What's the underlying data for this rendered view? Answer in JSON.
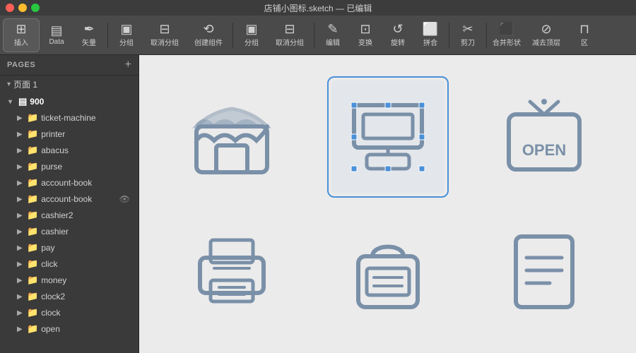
{
  "titlebar": {
    "title": "店铺小图标.sketch — 已编辑"
  },
  "toolbar": {
    "buttons": [
      {
        "label": "插入",
        "icon": "+",
        "id": "insert"
      },
      {
        "label": "Data",
        "icon": "≡",
        "id": "data"
      },
      {
        "label": "矢量",
        "icon": "✏",
        "id": "vector"
      },
      {
        "label": "分组",
        "icon": "⊞",
        "id": "group1"
      },
      {
        "label": "取消分组",
        "icon": "⊟",
        "id": "ungroup1"
      },
      {
        "label": "创建组件",
        "icon": "⟲",
        "id": "create-component"
      },
      {
        "label": "分组",
        "icon": "⊞",
        "id": "group2"
      },
      {
        "label": "取消分组",
        "icon": "⊟",
        "id": "ungroup2"
      },
      {
        "label": "编辑",
        "icon": "✎",
        "id": "edit"
      },
      {
        "label": "变换",
        "icon": "⊡",
        "id": "transform"
      },
      {
        "label": "旋转",
        "icon": "↺",
        "id": "rotate"
      },
      {
        "label": "拼合",
        "icon": "⬜",
        "id": "combine"
      },
      {
        "label": "剪刀",
        "icon": "✂",
        "id": "scissors"
      },
      {
        "label": "合并形状",
        "icon": "⬛",
        "id": "merge"
      },
      {
        "label": "减去顶层",
        "icon": "⬜",
        "id": "subtract"
      },
      {
        "label": "区",
        "icon": "⬜",
        "id": "intersect"
      }
    ]
  },
  "sidebar": {
    "pages_label": "PAGES",
    "pages_add": "+",
    "page_item": "页面 1",
    "layers_root": "900",
    "layers": [
      {
        "name": "ticket-machine",
        "type": "group",
        "indent": 1
      },
      {
        "name": "printer",
        "type": "group",
        "indent": 1
      },
      {
        "name": "abacus",
        "type": "group",
        "indent": 1
      },
      {
        "name": "purse",
        "type": "group",
        "indent": 1
      },
      {
        "name": "account-book",
        "type": "group",
        "indent": 1
      },
      {
        "name": "account-book",
        "type": "group",
        "indent": 1,
        "eye": true
      },
      {
        "name": "cashier2",
        "type": "group",
        "indent": 1
      },
      {
        "name": "cashier",
        "type": "group",
        "indent": 1
      },
      {
        "name": "pay",
        "type": "group",
        "indent": 1
      },
      {
        "name": "click",
        "type": "group",
        "indent": 1
      },
      {
        "name": "money",
        "type": "group",
        "indent": 1
      },
      {
        "name": "clock2",
        "type": "group",
        "indent": 1
      },
      {
        "name": "clock",
        "type": "group",
        "indent": 1
      },
      {
        "name": "open",
        "type": "group",
        "indent": 1
      }
    ]
  },
  "canvas": {
    "icons": [
      {
        "id": "store",
        "label": "Store icon",
        "selected": false
      },
      {
        "id": "cashier",
        "label": "Cashier icon",
        "selected": true
      },
      {
        "id": "open-sign",
        "label": "Open sign icon",
        "selected": false
      },
      {
        "id": "printer",
        "label": "Printer icon",
        "selected": false
      },
      {
        "id": "pay",
        "label": "Pay icon",
        "selected": false
      },
      {
        "id": "document",
        "label": "Document icon",
        "selected": false
      }
    ]
  }
}
